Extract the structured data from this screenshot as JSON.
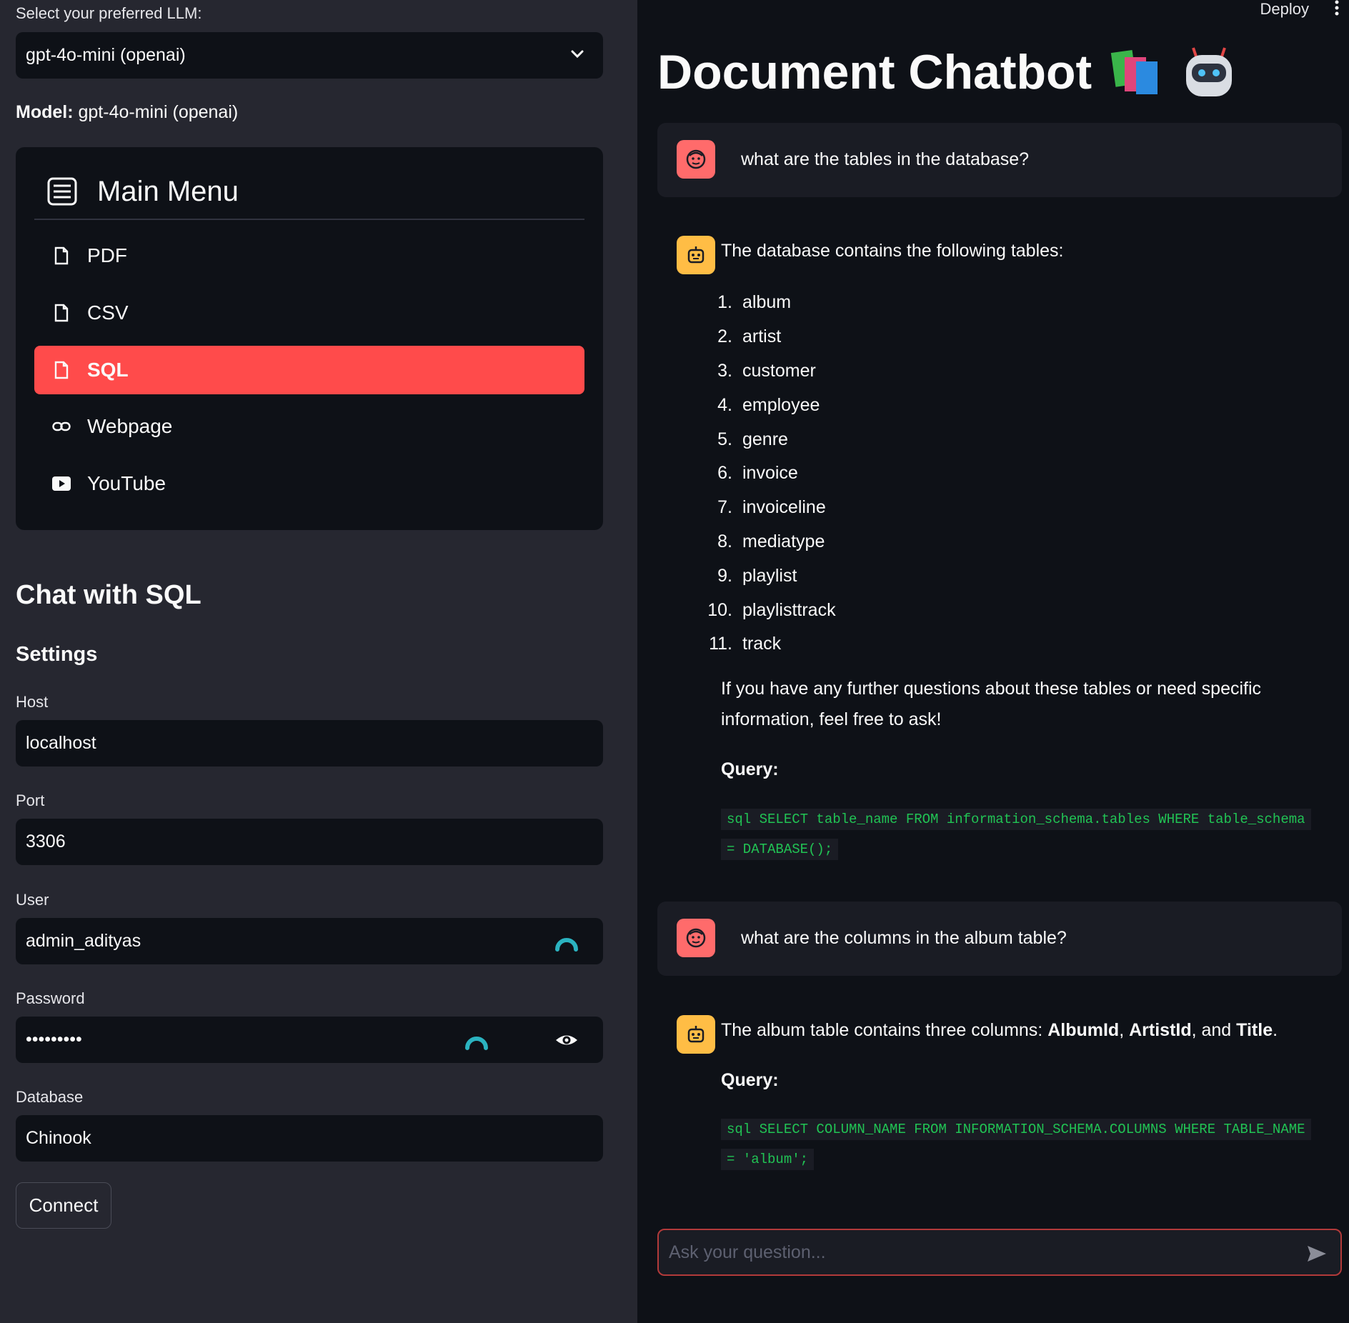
{
  "sidebar": {
    "llm_label": "Select your preferred LLM:",
    "llm_selected": "gpt-4o-mini (openai)",
    "model_prefix": "Model:",
    "model_value": " gpt-4o-mini (openai)",
    "menu": {
      "title": "Main Menu",
      "items": [
        {
          "label": "PDF",
          "icon": "file-icon",
          "active": false
        },
        {
          "label": "CSV",
          "icon": "file-icon",
          "active": false
        },
        {
          "label": "SQL",
          "icon": "file-icon",
          "active": true
        },
        {
          "label": "Webpage",
          "icon": "link-icon",
          "active": false
        },
        {
          "label": "YouTube",
          "icon": "youtube-icon",
          "active": false
        }
      ]
    },
    "section_title": "Chat with SQL",
    "settings_title": "Settings",
    "fields": {
      "host": {
        "label": "Host",
        "value": "localhost"
      },
      "port": {
        "label": "Port",
        "value": "3306"
      },
      "user": {
        "label": "User",
        "value": "admin_adityas"
      },
      "password": {
        "label": "Password",
        "value": "•••••••••"
      },
      "database": {
        "label": "Database",
        "value": "Chinook"
      }
    },
    "connect_label": "Connect"
  },
  "main": {
    "deploy_label": "Deploy",
    "title": "Document Chatbot",
    "messages": {
      "q1": "what are the tables in the database?",
      "a1_intro": "The database contains the following tables:",
      "a1_tables": [
        "album",
        "artist",
        "customer",
        "employee",
        "genre",
        "invoice",
        "invoiceline",
        "mediatype",
        "playlist",
        "playlisttrack",
        "track"
      ],
      "a1_outro_line1": "If you have any further questions about these tables or need specific",
      "a1_outro_line2": "information, feel free to ask!",
      "query_label": "Query:",
      "a1_query_line1": "sql SELECT table_name FROM information_schema.tables WHERE table_schema",
      "a1_query_line2": "= DATABASE();",
      "q2": "what are the columns in the album table?",
      "a2_prefix": "The album table contains three columns: ",
      "a2_col1": "AlbumId",
      "a2_sep1": ", ",
      "a2_col2": "ArtistId",
      "a2_sep2": ", and ",
      "a2_col3": "Title",
      "a2_end": ".",
      "a2_query_line1": "sql SELECT COLUMN_NAME FROM INFORMATION_SCHEMA.COLUMNS WHERE TABLE_NAME",
      "a2_query_line2": "= 'album';"
    },
    "input_placeholder": "Ask your question..."
  },
  "colors": {
    "accent": "#ff4b4b",
    "user_avatar": "#ff6b6b",
    "bot_avatar": "#ffbd45",
    "code": "#21c354"
  }
}
